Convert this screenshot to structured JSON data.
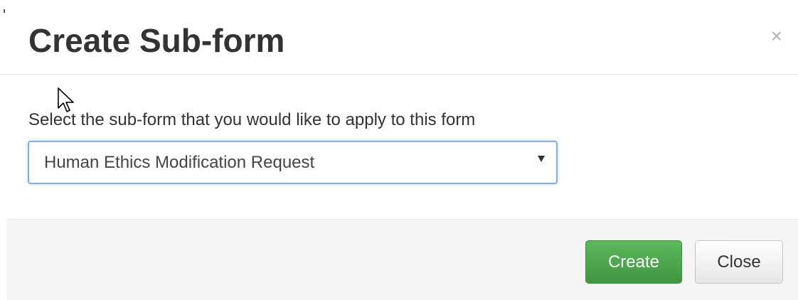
{
  "dialog": {
    "title": "Create Sub-form",
    "close_glyph": "×"
  },
  "body": {
    "prompt": "Select the sub-form that you would like to apply to this form",
    "subform_select": {
      "selected_value": "Human Ethics Modification Request"
    }
  },
  "footer": {
    "create_label": "Create",
    "close_label": "Close"
  },
  "colors": {
    "primary_green": "#5cb85c",
    "focus_blue": "#66afe9",
    "text_dark": "#333333"
  },
  "icons": {
    "close": "close-icon",
    "dropdown": "chevron-down-icon",
    "cursor": "mouse-pointer-icon"
  }
}
